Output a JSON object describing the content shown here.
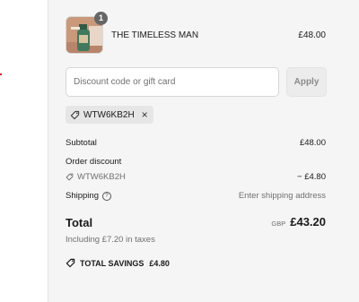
{
  "product": {
    "name": "THE TIMELESS MAN",
    "price": "£48.00",
    "quantity": "1"
  },
  "discount": {
    "placeholder": "Discount code or gift card",
    "apply_label": "Apply",
    "applied_code": "WTW6KB2H"
  },
  "summary": {
    "subtotal_label": "Subtotal",
    "subtotal_value": "£48.00",
    "order_discount_label": "Order discount",
    "discount_code": "WTW6KB2H",
    "discount_value": "− £4.80",
    "shipping_label": "Shipping",
    "shipping_value": "Enter shipping address",
    "total_label": "Total",
    "currency": "GBP",
    "total_value": "£43.20",
    "taxes_note": "Including £7.20 in taxes",
    "savings_label": "TOTAL SAVINGS",
    "savings_value": "£4.80"
  },
  "colors": {
    "panel_bg": "#f5f5f5",
    "muted_text": "#707070",
    "chip_bg": "#e6e6e6",
    "accent_dot": "#dd1111"
  }
}
